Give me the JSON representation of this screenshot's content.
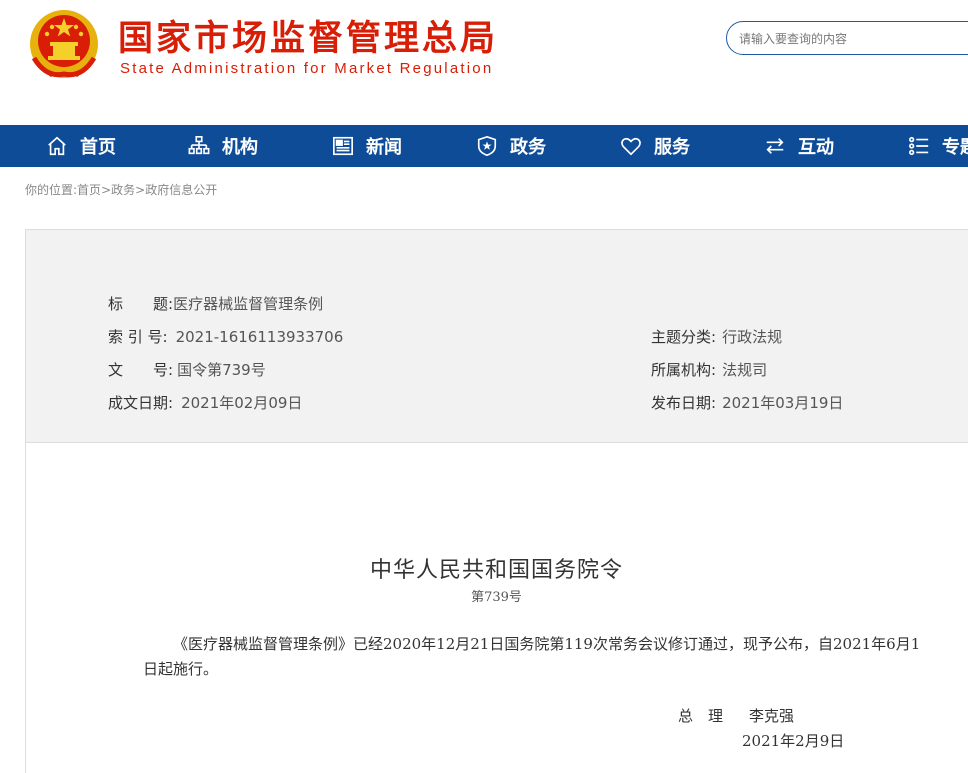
{
  "header": {
    "title": "国家市场监督管理总局",
    "subtitle": "State Administration for Market Regulation",
    "search_placeholder": "请输入要查询的内容",
    "emblem_icon": "national-emblem-icon",
    "brand_color": "#d81e06"
  },
  "nav": {
    "background": "#0f4c98",
    "items": [
      {
        "label": "首页",
        "icon": "home-icon"
      },
      {
        "label": "机构",
        "icon": "org-chart-icon"
      },
      {
        "label": "新闻",
        "icon": "news-icon"
      },
      {
        "label": "政务",
        "icon": "shield-icon"
      },
      {
        "label": "服务",
        "icon": "heart-icon"
      },
      {
        "label": "互动",
        "icon": "exchange-icon"
      },
      {
        "label": "专题",
        "icon": "list-icon"
      }
    ]
  },
  "breadcrumb": {
    "prefix": "你的位置:",
    "items": [
      "首页",
      "政务",
      "政府信息公开"
    ],
    "separator": ">"
  },
  "info": {
    "title_label": "标　　题:",
    "title_value": "医疗器械监督管理条例",
    "index_label": "索 引 号:",
    "index_value": "2021-1616113933706",
    "doc_no_label": "文　　号:",
    "doc_no_value": "国令第739号",
    "date_label": "成文日期:",
    "date_value": "2021年02月09日",
    "topic_label": "主题分类:",
    "topic_value": "行政法规",
    "org_label": "所属机构:",
    "org_value": "法规司",
    "publish_label": "发布日期:",
    "publish_value": "2021年03月19日"
  },
  "document": {
    "title": "中华人民共和国国务院令",
    "number": "第739号",
    "body": "《医疗器械监督管理条例》已经2020年12月21日国务院第119次常务会议修订通过，现予公布，自2021年6月1日起施行。",
    "signer_title": "总　理",
    "signer_name": "李克强",
    "date": "2021年2月9日"
  }
}
